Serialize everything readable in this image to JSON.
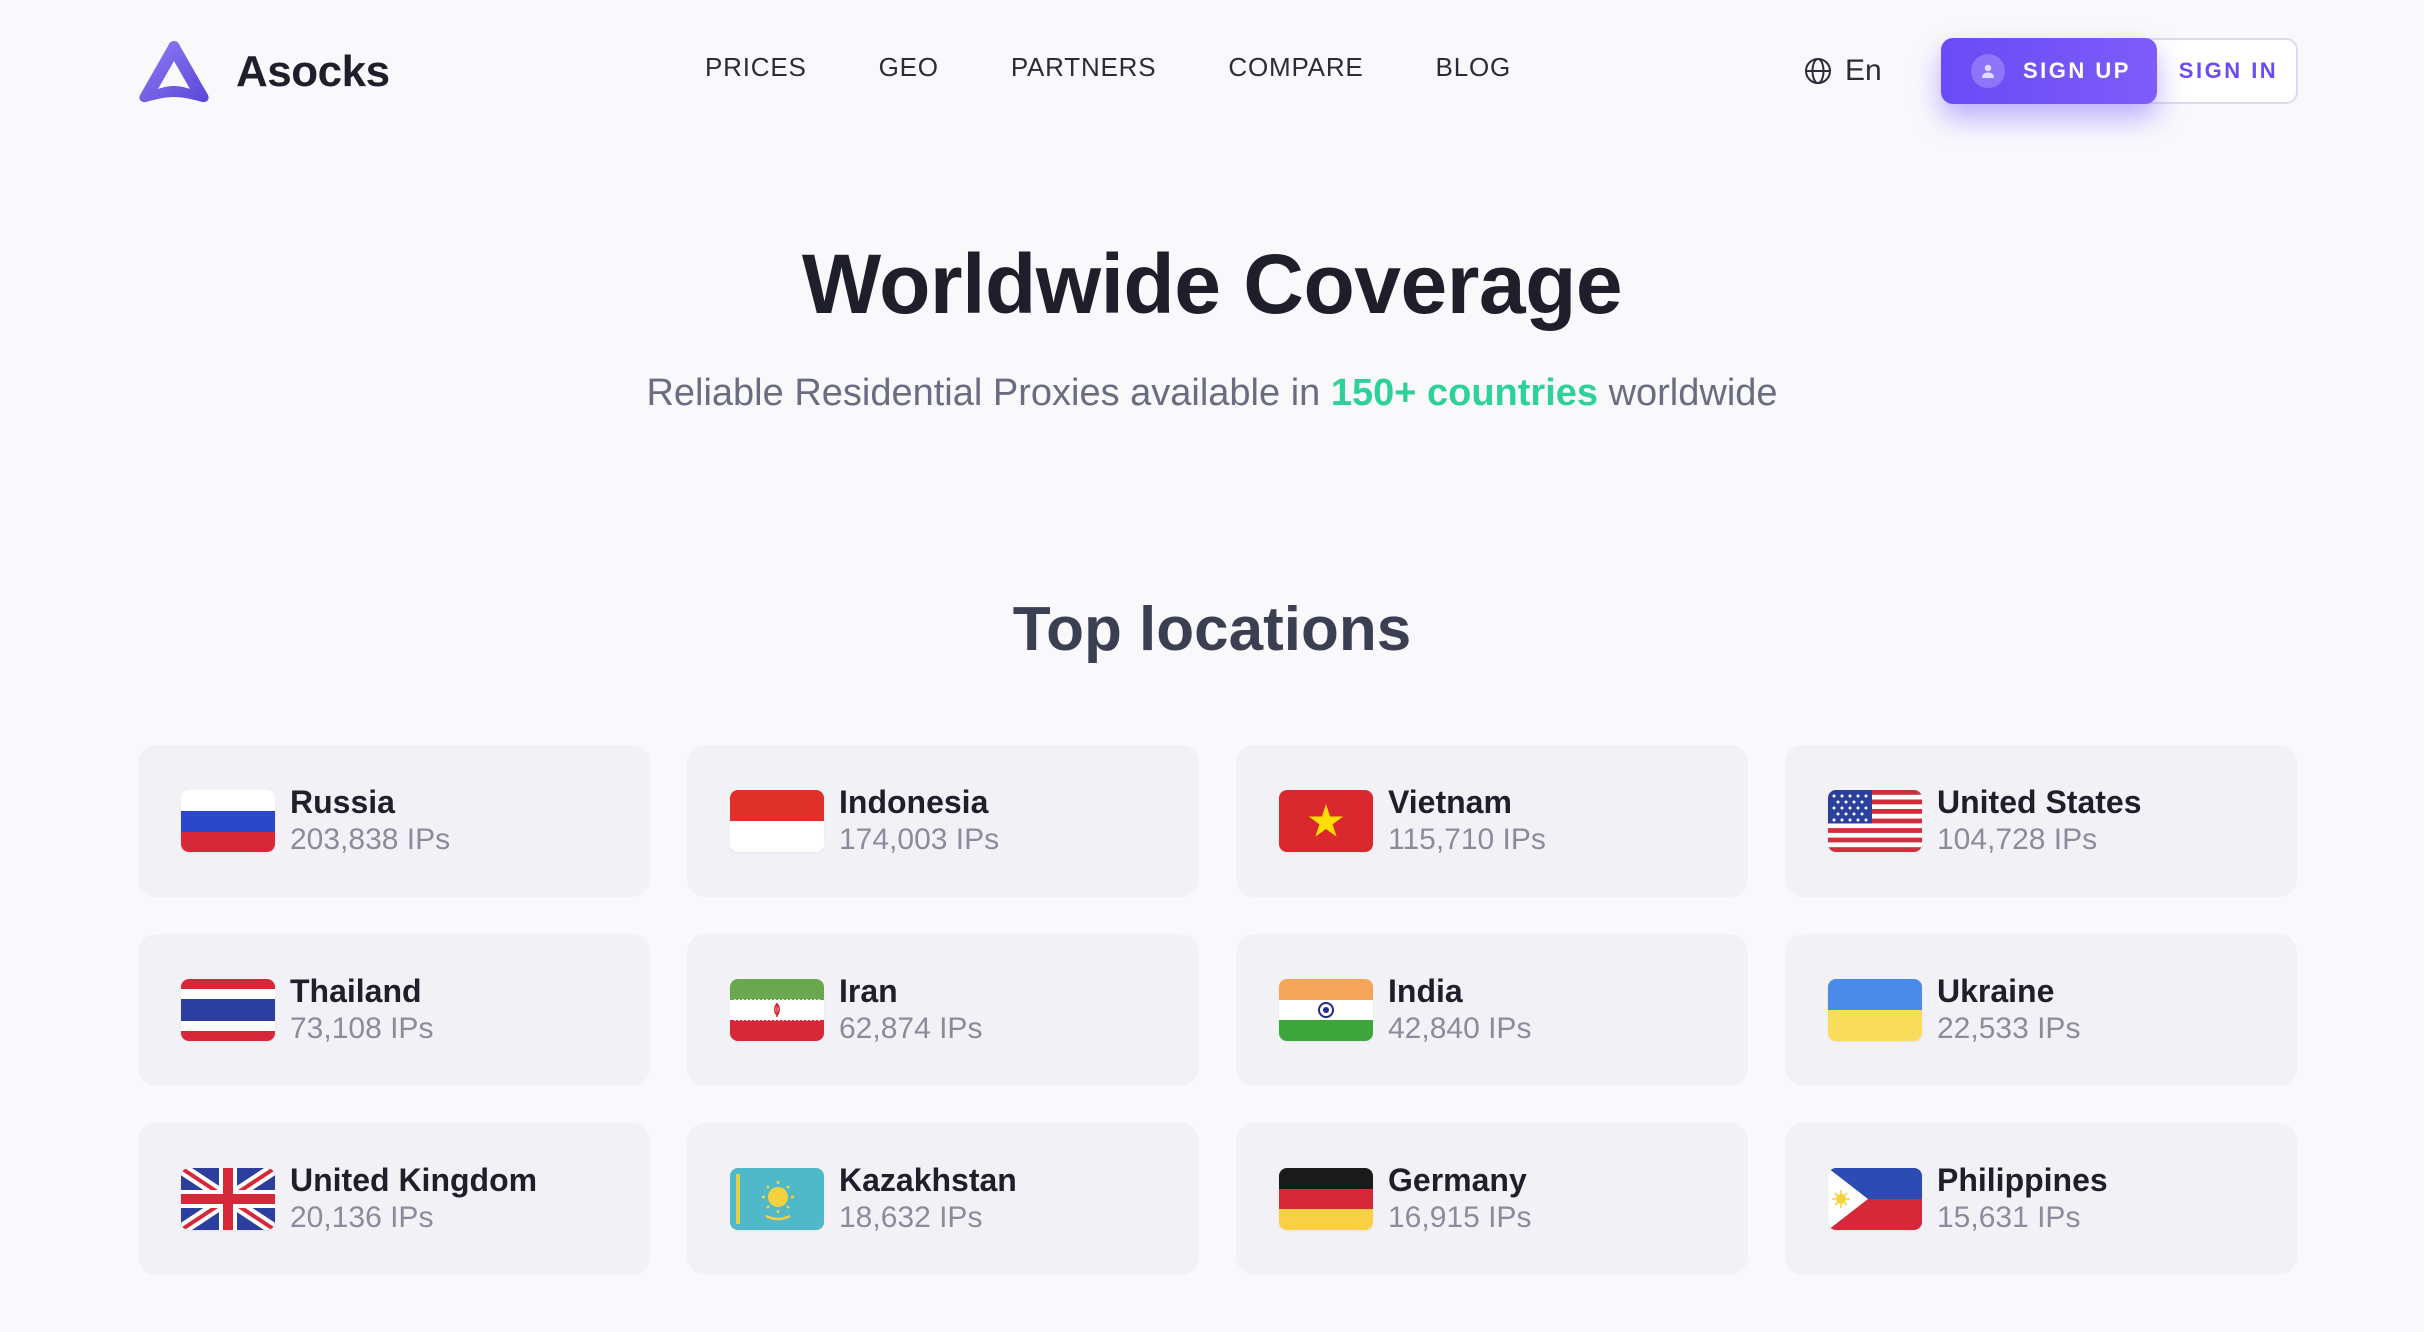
{
  "brand": {
    "name": "Asocks",
    "accent": "#6a4bf5",
    "highlight": "#2fd19a"
  },
  "nav": {
    "items": [
      {
        "label": "PRICES"
      },
      {
        "label": "GEO"
      },
      {
        "label": "PARTNERS"
      },
      {
        "label": "COMPARE"
      },
      {
        "label": "BLOG"
      }
    ]
  },
  "header": {
    "language": "En",
    "sign_up": "SIGN UP",
    "sign_in": "SIGN IN"
  },
  "hero": {
    "title": "Worldwide Coverage",
    "subtitle_before": "Reliable Residential Proxies available in ",
    "subtitle_highlight": "150+ countries",
    "subtitle_after": " worldwide"
  },
  "locations": {
    "title": "Top locations",
    "items": [
      {
        "country": "Russia",
        "ips": "203,838 IPs",
        "flag": "russia-flag-icon"
      },
      {
        "country": "Indonesia",
        "ips": "174,003 IPs",
        "flag": "indonesia-flag-icon"
      },
      {
        "country": "Vietnam",
        "ips": "115,710 IPs",
        "flag": "vietnam-flag-icon"
      },
      {
        "country": "United States",
        "ips": "104,728 IPs",
        "flag": "united-states-flag-icon"
      },
      {
        "country": "Thailand",
        "ips": "73,108 IPs",
        "flag": "thailand-flag-icon"
      },
      {
        "country": "Iran",
        "ips": "62,874 IPs",
        "flag": "iran-flag-icon"
      },
      {
        "country": "India",
        "ips": "42,840 IPs",
        "flag": "india-flag-icon"
      },
      {
        "country": "Ukraine",
        "ips": "22,533 IPs",
        "flag": "ukraine-flag-icon"
      },
      {
        "country": "United Kingdom",
        "ips": "20,136 IPs",
        "flag": "united-kingdom-flag-icon"
      },
      {
        "country": "Kazakhstan",
        "ips": "18,632 IPs",
        "flag": "kazakhstan-flag-icon"
      },
      {
        "country": "Germany",
        "ips": "16,915 IPs",
        "flag": "germany-flag-icon"
      },
      {
        "country": "Philippines",
        "ips": "15,631 IPs",
        "flag": "philippines-flag-icon"
      }
    ]
  }
}
